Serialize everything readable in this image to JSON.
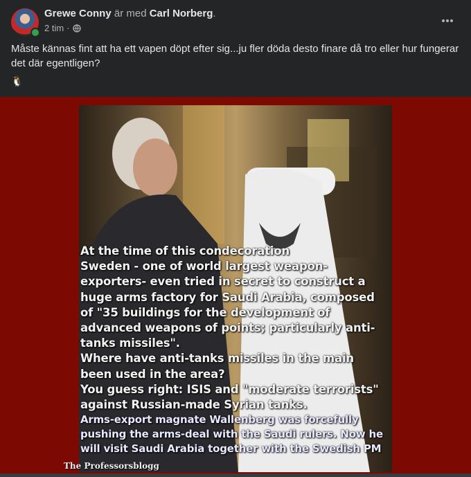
{
  "post": {
    "author": "Grewe Conny",
    "with_text": "är med",
    "tagged": "Carl Norberg",
    "period": ".",
    "time": "2 tim",
    "separator": "·",
    "text": "Måste kännas fint att ha ett vapen döpt efter sig...ju fler döda desto finare då tro eller hur fungerar det där egentligen?",
    "emoji": "🐧"
  },
  "image": {
    "lines": [
      "At the time of this condecoration",
      "Sweden - one of world largest weapon-",
      "exporters- even tried  in secret to construct a",
      "huge arms factory for Saudi Arabia, composed",
      "of \"35 buildings for the development of",
      "advanced weapons of points; particularly anti-",
      "tanks missiles\".",
      "Where have anti-tanks missiles in the main",
      "been used in the area?",
      "You guess right:  ISIS and \"moderate terrorists\"",
      "against Russian-made Syrian tanks."
    ],
    "blue_lines": [
      "Arms-export  magnate Wallenberg was forcefully",
      "pushing the arms-deal with the Saudi rulers. Now he",
      "will visit Saudi Arabia together  with  the Swedish PM"
    ],
    "watermark": "The Professorsblogg"
  },
  "colors": {
    "accent_online": "#31a24c",
    "photo_bg": "#7d0a02"
  },
  "icons": {
    "more": "more-horizontal-icon",
    "privacy": "globe-icon"
  }
}
